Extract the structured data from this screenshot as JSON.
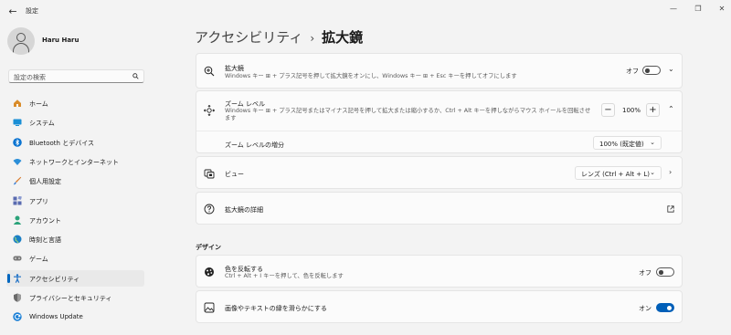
{
  "window": {
    "title": "設定"
  },
  "user": {
    "name": "Haru Haru"
  },
  "search": {
    "placeholder": "設定の検索"
  },
  "sidebar": {
    "items": [
      {
        "label": "ホーム",
        "icon": "home-icon",
        "color": "#d98c2b"
      },
      {
        "label": "システム",
        "icon": "monitor-icon",
        "color": "#1a8fd6"
      },
      {
        "label": "Bluetooth とデバイス",
        "icon": "bluetooth-icon",
        "color": "#0a74d1"
      },
      {
        "label": "ネットワークとインターネット",
        "icon": "wifi-icon",
        "color": "#2c8fd8"
      },
      {
        "label": "個人用設定",
        "icon": "brush-icon",
        "color": "#d87a2b"
      },
      {
        "label": "アプリ",
        "icon": "apps-icon",
        "color": "#5a6bb0"
      },
      {
        "label": "アカウント",
        "icon": "account-icon",
        "color": "#2ba37a"
      },
      {
        "label": "時刻と言語",
        "icon": "globe-icon",
        "color": "#1a7fc6"
      },
      {
        "label": "ゲーム",
        "icon": "gamepad-icon",
        "color": "#777777"
      },
      {
        "label": "アクセシビリティ",
        "icon": "accessibility-icon",
        "color": "#1a6fc6",
        "active": true
      },
      {
        "label": "プライバシーとセキュリティ",
        "icon": "shield-icon",
        "color": "#6a6a6a"
      },
      {
        "label": "Windows Update",
        "icon": "update-icon",
        "color": "#1a7fd6"
      }
    ]
  },
  "breadcrumb": {
    "parent": "アクセシビリティ",
    "separator": "›",
    "current": "拡大鏡"
  },
  "magnifier": {
    "title": "拡大鏡",
    "description": "Windows キー ⊞ + プラス記号を押して拡大鏡をオンにし、Windows キー ⊞ + Esc キーを押してオフにします",
    "toggle_label": "オフ",
    "enabled": false
  },
  "zoom": {
    "title": "ズーム レベル",
    "description": "Windows キー ⊞ + プラス記号またはマイナス記号を押して拡大または縮小するか、Ctrl + Alt キーを押しながらマウス ホイールを回転させます",
    "minus": "−",
    "value": "100%",
    "plus": "+",
    "increment_label": "ズーム レベルの増分",
    "increment_value": "100% (既定値)"
  },
  "view": {
    "title": "ビュー",
    "value": "レンズ (Ctrl + Alt + L)"
  },
  "details": {
    "title": "拡大鏡の詳細"
  },
  "design": {
    "heading": "デザイン",
    "invert": {
      "title": "色を反転する",
      "description": "Ctrl + Alt + I キーを押して、色を反転します",
      "toggle_label": "オフ",
      "enabled": false
    },
    "smooth": {
      "title": "画像やテキストの縁を滑らかにする",
      "toggle_label": "オン",
      "enabled": true
    }
  },
  "colors": {
    "accent": "#005fb8"
  }
}
